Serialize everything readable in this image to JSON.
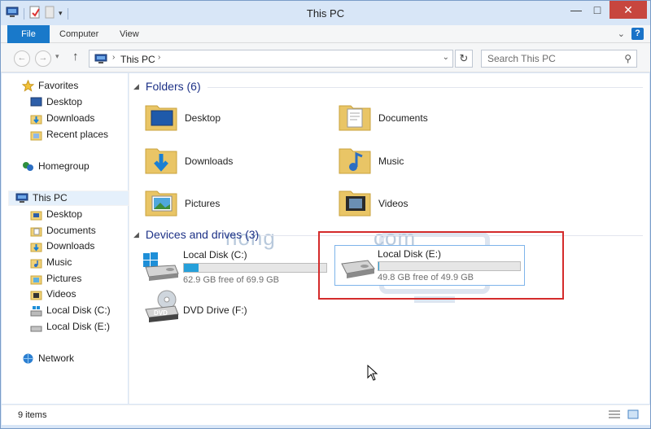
{
  "window": {
    "title": "This PC",
    "minimize_glyph": "—",
    "maximize_glyph": "□",
    "close_glyph": "✕"
  },
  "ribbon": {
    "tabs": [
      {
        "label": "File"
      },
      {
        "label": "Computer"
      },
      {
        "label": "View"
      }
    ],
    "help_glyph": "?"
  },
  "address_bar": {
    "path": "This PC",
    "search_placeholder": "Search This PC"
  },
  "sidebar": {
    "items": [
      {
        "label": "Favorites",
        "icon": "star-icon"
      },
      {
        "label": "Desktop",
        "icon": "desktop-icon"
      },
      {
        "label": "Downloads",
        "icon": "downloads-folder-icon"
      },
      {
        "label": "Recent places",
        "icon": "recent-places-icon"
      },
      {
        "label": "Homegroup",
        "icon": "homegroup-icon"
      },
      {
        "label": "This PC",
        "icon": "pc-icon",
        "selected": true
      },
      {
        "label": "Desktop",
        "icon": "folder-icon"
      },
      {
        "label": "Documents",
        "icon": "folder-icon"
      },
      {
        "label": "Downloads",
        "icon": "folder-icon"
      },
      {
        "label": "Music",
        "icon": "folder-icon"
      },
      {
        "label": "Pictures",
        "icon": "folder-icon"
      },
      {
        "label": "Videos",
        "icon": "folder-icon"
      },
      {
        "label": "Local Disk (C:)",
        "icon": "windows-drive-icon"
      },
      {
        "label": "Local Disk (E:)",
        "icon": "drive-icon"
      },
      {
        "label": "Network",
        "icon": "network-icon"
      }
    ]
  },
  "content": {
    "folders_group": "Folders (6)",
    "folders": [
      {
        "name": "Desktop",
        "icon": "desktop-folder-icon"
      },
      {
        "name": "Documents",
        "icon": "documents-folder-icon"
      },
      {
        "name": "Downloads",
        "icon": "downloads-folder-icon"
      },
      {
        "name": "Music",
        "icon": "music-folder-icon"
      },
      {
        "name": "Pictures",
        "icon": "pictures-folder-icon"
      },
      {
        "name": "Videos",
        "icon": "videos-folder-icon"
      }
    ],
    "drives_group": "Devices and drives (3)",
    "drives": [
      {
        "name": "Local Disk (C:)",
        "free": "62.9 GB free of 69.9 GB",
        "used_fraction": 0.1,
        "icon": "windows-drive-icon"
      },
      {
        "name": "Local Disk (E:)",
        "free": "49.8 GB free of 49.9 GB",
        "used_fraction": 0.002,
        "icon": "drive-icon",
        "highlighted": true
      },
      {
        "name": "DVD Drive (F:)",
        "icon": "dvd-drive-icon"
      }
    ]
  },
  "watermark": {
    "text": "nong",
    "text2": "com"
  },
  "status": {
    "items": "9 items"
  },
  "colors": {
    "accent": "#1979ca",
    "progress": "#26a0da",
    "highlight_box": "#d42b2b",
    "group_title": "#1e3287"
  }
}
